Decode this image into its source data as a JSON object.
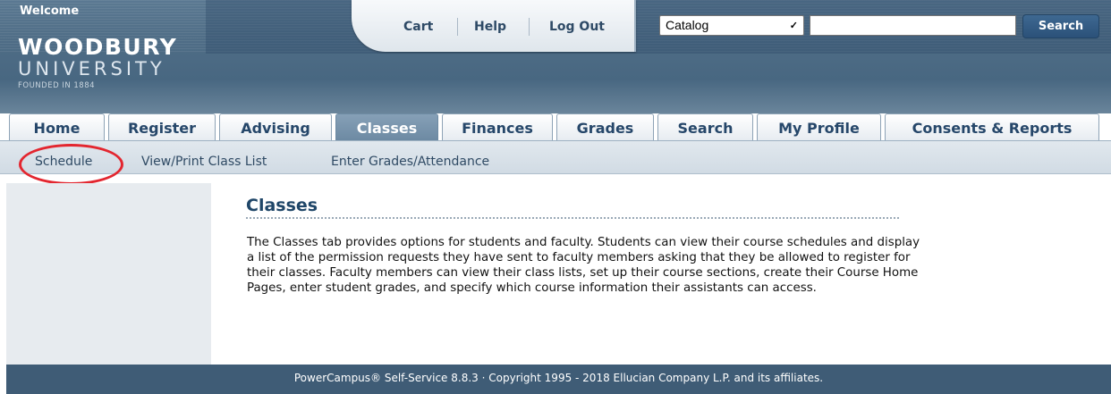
{
  "header": {
    "welcome": "Welcome",
    "logo": {
      "line1": "WOODBURY",
      "line2": "UNIVERSITY",
      "line3": "FOUNDED IN 1884"
    },
    "links": {
      "cart": "Cart",
      "help": "Help",
      "logout": "Log Out"
    },
    "search": {
      "scope_selected": "Catalog",
      "query": "",
      "button": "Search"
    }
  },
  "tabs": [
    {
      "label": "Home"
    },
    {
      "label": "Register"
    },
    {
      "label": "Advising"
    },
    {
      "label": "Classes",
      "active": true
    },
    {
      "label": "Finances"
    },
    {
      "label": "Grades"
    },
    {
      "label": "Search"
    },
    {
      "label": "My Profile"
    },
    {
      "label": "Consents & Reports"
    }
  ],
  "subnav": [
    {
      "label": "Schedule",
      "highlighted": true
    },
    {
      "label": "View/Print Class List"
    },
    {
      "label": "Enter Grades/Attendance"
    }
  ],
  "content": {
    "title": "Classes",
    "description": "The Classes tab provides options for students and faculty. Students can view their course schedules and display a list of the permission requests they have sent to faculty members asking that they be allowed to register for their classes. Faculty members can view their class lists, set up their course sections, create their Course Home Pages, enter student grades, and specify which course information their assistants can access."
  },
  "footer": {
    "text": "PowerCampus® Self-Service 8.8.3 · Copyright 1995 - 2018 Ellucian Company L.P. and its affiliates."
  },
  "colors": {
    "header_blue": "#4f6d86",
    "tab_active": "#6d8aa3",
    "highlight_ring": "#e3262f",
    "footer_bg": "#3f5c76",
    "title_blue": "#1f4668"
  },
  "icons": {
    "select_chevron": "chevron-down-icon"
  }
}
